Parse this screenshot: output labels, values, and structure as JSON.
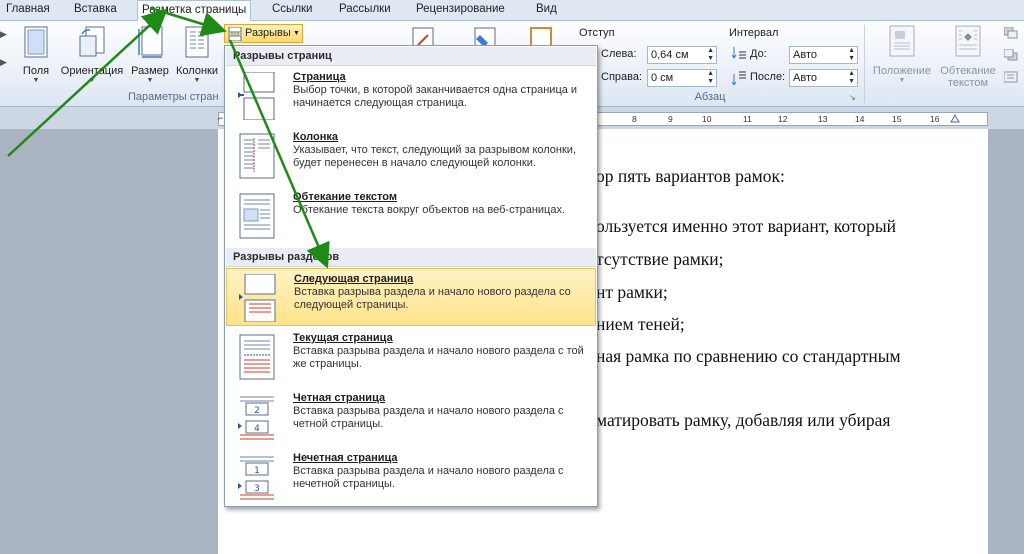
{
  "tabs": [
    "Главная",
    "Вставка",
    "Разметка страницы",
    "Ссылки",
    "Рассылки",
    "Рецензирование",
    "Вид"
  ],
  "ribbon": {
    "page_setup": {
      "buttons": [
        "Поля",
        "Ориентация",
        "Размер",
        "Колонки"
      ],
      "label": "Параметры стран"
    },
    "breaks_button": "Разрывы",
    "indent": {
      "title": "Отступ",
      "left_label": "Слева:",
      "left_value": "0,64 см",
      "right_label": "Справа:",
      "right_value": "0 см"
    },
    "spacing": {
      "title": "Интервал",
      "before_label": "До:",
      "before_value": "Авто",
      "after_label": "После:",
      "after_value": "Авто"
    },
    "paragraph_label": "Абзац",
    "arrange": {
      "position": "Положение",
      "wrap_line1": "Обтекание",
      "wrap_line2": "текстом"
    }
  },
  "ruler": [
    "8",
    "9",
    "10",
    "11",
    "12",
    "13",
    "14",
    "15",
    "16"
  ],
  "menu": {
    "page_breaks_header": "Разрывы страниц",
    "section_breaks_header": "Разрывы разделов",
    "page_items": [
      {
        "title": "Страница",
        "desc": "Выбор точки, в которой заканчивается одна страница и начинается следующая страница."
      },
      {
        "title": "Колонка",
        "desc": "Указывает, что текст, следующий за разрывом колонки, будет перенесен в начало следующей колонки."
      },
      {
        "title": "Обтекание текстом",
        "desc": "Обтекание текста вокруг объектов на веб-страницах."
      }
    ],
    "section_items": [
      {
        "title": "Следующая страница",
        "desc": "Вставка разрыва раздела и начало нового раздела со следующей страницы."
      },
      {
        "title": "Текущая страница",
        "desc": "Вставка разрыва раздела и начало нового раздела с той же страницы."
      },
      {
        "title": "Четная страница",
        "desc": "Вставка разрыва раздела и начало нового раздела с четной страницы."
      },
      {
        "title": "Нечетная страница",
        "desc": "Вставка разрыва раздела и начало нового раздела с нечетной страницы."
      }
    ]
  },
  "document": {
    "lines": [
      "ор пять вариантов рамок:",
      "ользуется  именно  этот  вариант,  который",
      "тсутствие рамки;",
      "нт рамки;",
      "нием теней;",
      "ная  рамка  по  сравнению  со  стандартным",
      "матировать  рамку,  добавляя  или  убирая"
    ]
  },
  "colors": {
    "arrow": "#1f8a16",
    "highlight": "#ffe28a",
    "accent": "#2b579a"
  }
}
